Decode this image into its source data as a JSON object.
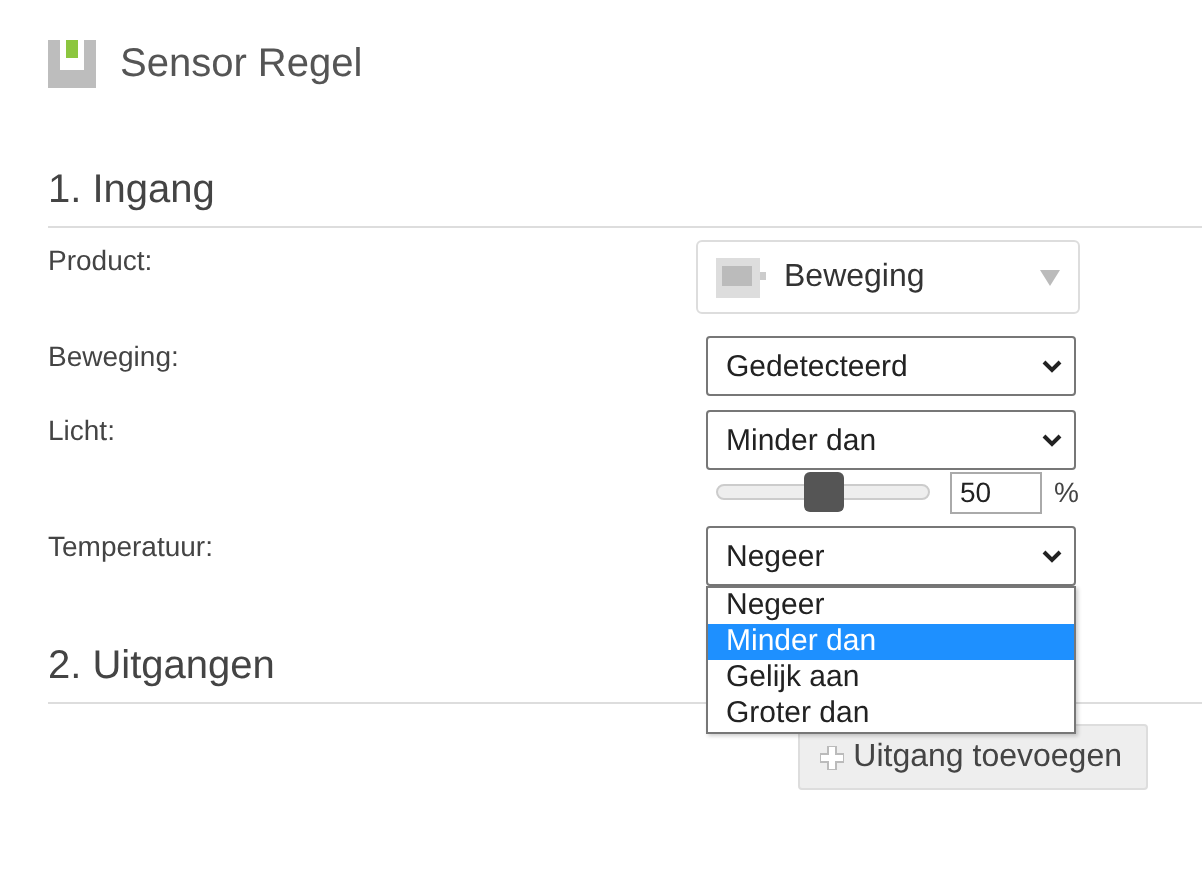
{
  "title": "Sensor Regel",
  "input_section": {
    "heading": "1. Ingang",
    "fields": [
      {
        "kind": "product",
        "label": "Product:",
        "value": "Beweging"
      },
      {
        "kind": "select",
        "label": "Beweging:",
        "value": "Gedetecteerd"
      },
      {
        "kind": "select",
        "label": "Licht:",
        "value": "Minder dan",
        "slider": {
          "level": 0.5,
          "value": "50",
          "unit": "%"
        }
      },
      {
        "kind": "select",
        "label": "Temperatuur:",
        "value": "Negeer",
        "expanded": true,
        "options": [
          {
            "label": "Negeer",
            "highlighted": false
          },
          {
            "label": "Minder dan",
            "highlighted": true
          },
          {
            "label": "Gelijk aan",
            "highlighted": false
          },
          {
            "label": "Groter dan",
            "highlighted": false
          }
        ]
      }
    ]
  },
  "output_section": {
    "heading": "2. Uitgangen",
    "button": "Uitgang toevoegen"
  }
}
